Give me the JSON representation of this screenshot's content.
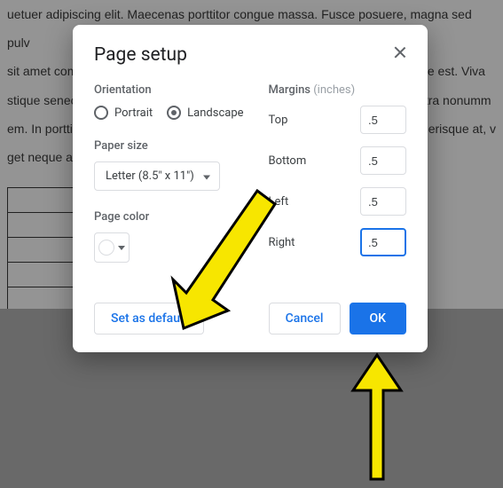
{
  "background": {
    "line1": "uetuer adipiscing elit. Maecenas porttitor congue massa. Fusce posuere, magna sed pulv",
    "line2": "sit amet commodo magna eros quis urna. Nunc viverra imperdiet enim. Fusce est. Viva",
    "line3": "stique senectus et netus et malesuada fames ac turpis egestas. Proin pharetra nonumm",
    "line4": "em. In porttitor. Donec laoreet nonummy augue. Suspendisse dui purus, scelerisque at, v",
    "line5": "get neque at dolor venenatis consequat."
  },
  "dialog": {
    "title": "Page setup",
    "orientation": {
      "label": "Orientation",
      "portrait": "Portrait",
      "landscape": "Landscape",
      "selected": "landscape"
    },
    "paperSize": {
      "label": "Paper size",
      "value": "Letter (8.5\" x 11\")"
    },
    "pageColor": {
      "label": "Page color",
      "value": "#ffffff"
    },
    "margins": {
      "label": "Margins",
      "unit": "(inches)",
      "top": {
        "label": "Top",
        "value": ".5"
      },
      "bottom": {
        "label": "Bottom",
        "value": ".5"
      },
      "left": {
        "label": "Left",
        "value": ".5"
      },
      "right": {
        "label": "Right",
        "value": ".5"
      }
    },
    "buttons": {
      "setDefault": "Set as default",
      "cancel": "Cancel",
      "ok": "OK"
    }
  }
}
